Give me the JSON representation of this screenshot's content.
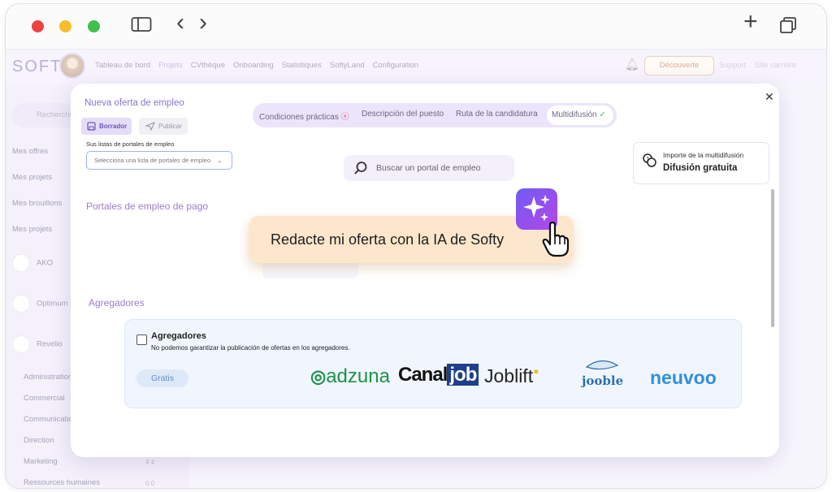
{
  "browser": {
    "nav_back": "‹",
    "nav_forward": "›",
    "new_tab": "+",
    "tabs_icon": "tabs-icon"
  },
  "topnav": {
    "logo": "SOFTY",
    "items": [
      "Tableau de bord",
      "Projets",
      "CVthèque",
      "Onboarding",
      "Statistiques",
      "SoftyLand",
      "Configuration"
    ],
    "decouverte": "Découverte",
    "support": "Support",
    "site": "Site carrière"
  },
  "sidebar": {
    "search_placeholder": "Recherche",
    "items": [
      "Mes offres",
      "Mes projets",
      "Mes brouillons",
      "Mes projets"
    ],
    "orgs": [
      "AKO",
      "Optimum",
      "Revelio"
    ],
    "folders": [
      {
        "label": "Administration",
        "count": ""
      },
      {
        "label": "Commercial",
        "count": ""
      },
      {
        "label": "Communication",
        "count": ""
      },
      {
        "label": "Direction",
        "count": ""
      },
      {
        "label": "Marketing",
        "count": "4  4"
      },
      {
        "label": "Ressources humaines",
        "count": "0  0"
      }
    ]
  },
  "modal": {
    "title": "Nueva oferta de empleo",
    "draft_button": "Borrador",
    "publish_button": "Publicar",
    "lists_label": "Sus listas de portales de empleo",
    "lists_placeholder": "Selecciona una lista de portales de empleo",
    "tabs": [
      "Condiciones prácticas",
      "Descripción del puesto",
      "Ruta de la candidatura",
      "Multidifusión"
    ],
    "search_placeholder": "Buscar un portal de empleo",
    "importe_label": "Importe de la multidifusión",
    "importe_value": "Difusión gratuita",
    "paid_portals_title": "Portales de empleo de pago",
    "aggregators_title": "Agregadores",
    "aggregators_box_title": "Agregadores",
    "aggregators_note": "No podemos garantizar la publicación de ofertas en los agregadores.",
    "gratis": "Gratis",
    "brands": {
      "adzuna": "adzuna",
      "canal": "Canal",
      "job": "job",
      "joblift": "Joblift",
      "jooble": "jooble",
      "neuvoo": "neuvoo"
    }
  },
  "ia_banner": "Redacte mi oferta con la IA de Softy",
  "colors": {
    "accent": "#8b73d6",
    "banner_bg": "#fde7cc",
    "adzuna": "#1a9448",
    "neuvoo": "#2f8fe0"
  }
}
